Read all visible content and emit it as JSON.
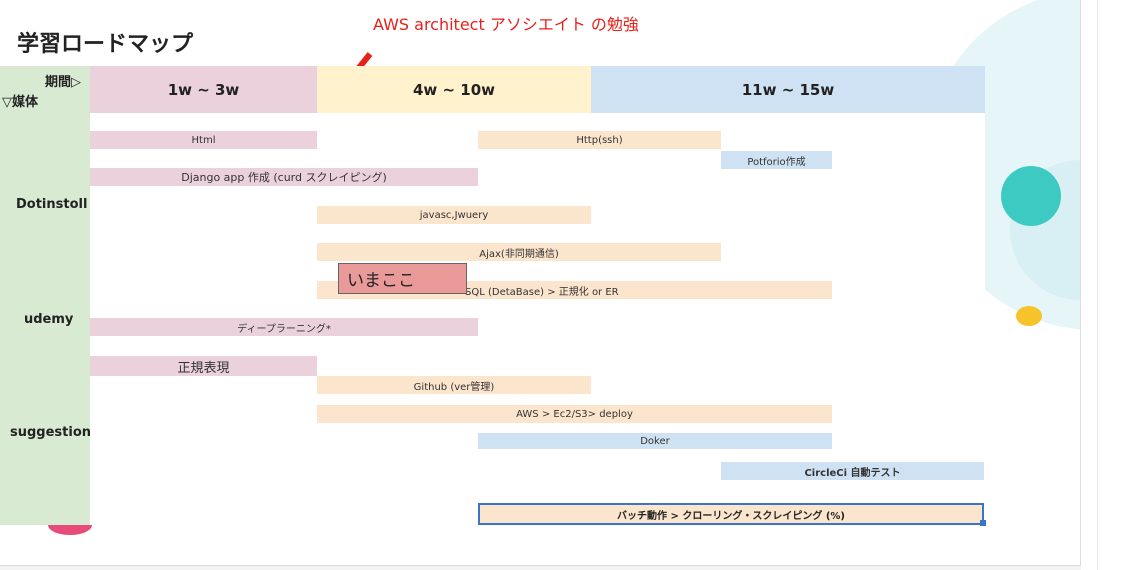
{
  "slide": {
    "title": "学習ロードマップ",
    "annotation": "AWS architect アソシエイト の勉強",
    "corner": {
      "period_label": "期間▷",
      "media_label": "▽媒体"
    },
    "periods": [
      "1w ~ 3w",
      "4w ~ 10w",
      "11w ~ 15w"
    ],
    "media": [
      "Dotinstoll",
      "udemy",
      "suggestion"
    ],
    "tasks": [
      {
        "label": "Html",
        "color": "pink"
      },
      {
        "label": "Http(ssh)",
        "color": "peach"
      },
      {
        "label": "Potforio作成",
        "color": "blue"
      },
      {
        "label": "Django app 作成 (curd スクレイピング)",
        "color": "pink"
      },
      {
        "label": "javasc,Jwuery",
        "color": "peach"
      },
      {
        "label": "Ajax(非同期通信)",
        "color": "peach"
      },
      {
        "label": "SQL (DetaBase) > 正規化 or ER",
        "color": "peach"
      },
      {
        "label": "ディープラーニング*",
        "color": "pink"
      },
      {
        "label": "正規表現",
        "color": "pink"
      },
      {
        "label": "Github (ver管理)",
        "color": "peach"
      },
      {
        "label": "AWS > Ec2/S3> deploy",
        "color": "peach"
      },
      {
        "label": "Doker",
        "color": "blue"
      },
      {
        "label": "CircleCi 自動テスト",
        "color": "blue"
      }
    ],
    "current_marker": "いまここ",
    "selected_task": "バッチ動作 > クローリング・スクレイピング (%)"
  },
  "colors": {
    "annotation_red": "#e8201a",
    "media_column": "#d9ead3",
    "period_1": "#ead1dc",
    "period_2": "#fff2cc",
    "period_3": "#cfe2f3",
    "current_marker": "#ea9999",
    "selection": "#3b73c6"
  }
}
